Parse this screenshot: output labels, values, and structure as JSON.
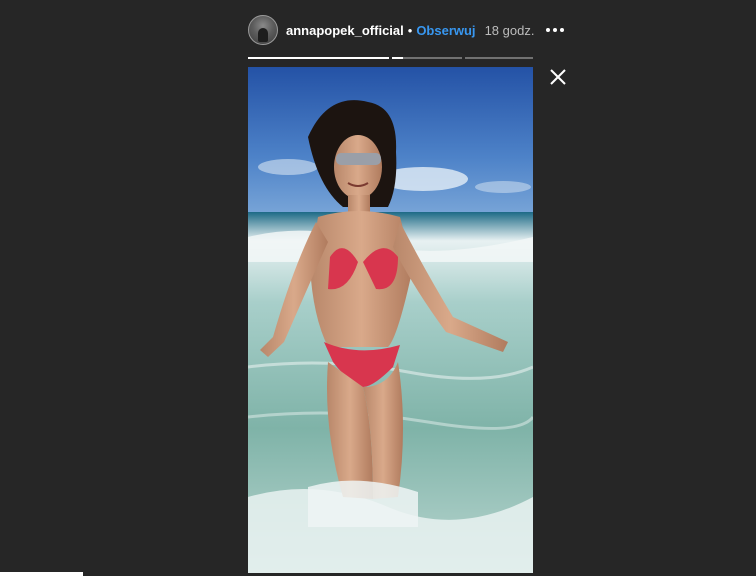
{
  "story": {
    "username": "annapopek_official",
    "separator": "•",
    "follow_label": "Obserwuj",
    "timestamp": "18 godz.",
    "progress": [
      1.0,
      0.15,
      0.0
    ],
    "photo_description_icon": "beach-photo",
    "close_icon": "close-icon",
    "more_icon": "more-options-icon"
  },
  "colors": {
    "background": "#262626",
    "follow_blue": "#3897f0",
    "sky": "#2f63b0",
    "sea": "#7fb3b0",
    "bikini": "#d8364e"
  }
}
